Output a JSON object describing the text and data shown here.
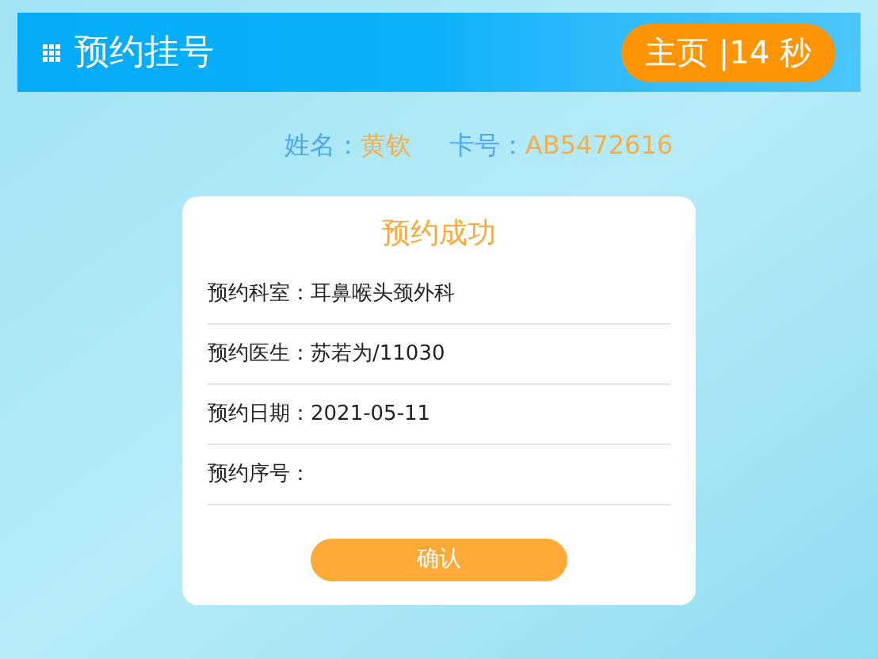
{
  "header": {
    "title": "预约挂号",
    "home_button": "主页 |14 秒"
  },
  "patient": {
    "name_label": "姓名：",
    "name": "黄钦",
    "card_label": "卡号：",
    "card": "AB5472616"
  },
  "card": {
    "title": "预约成功",
    "rows": [
      {
        "label": "预约科室：",
        "value": "耳鼻喉头颈外科"
      },
      {
        "label": "预约医生：",
        "value": "苏若为/11030"
      },
      {
        "label": "预约日期：",
        "value": "2021-05-11"
      },
      {
        "label": "预约序号："
      }
    ],
    "confirm_button": "确认"
  }
}
